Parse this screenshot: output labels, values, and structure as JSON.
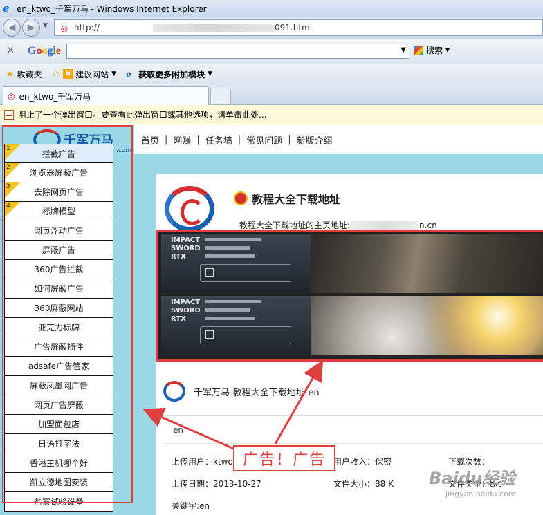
{
  "window": {
    "title": "en_ktwo_千军万马 - Windows Internet Explorer"
  },
  "address_bar": {
    "url_prefix": "http://",
    "url_suffix": "091.html"
  },
  "google_toolbar": {
    "logo": "Google",
    "search_label": "搜索"
  },
  "favorites_bar": {
    "favorites": "收藏夹",
    "suggested": "建议网站",
    "addons": "获取更多附加模块"
  },
  "tab": {
    "title": "en_ktwo_千军万马"
  },
  "info_bar": {
    "text": "阻止了一个弹出窗口。要查看此弹出窗口或其他选项，请单击此处..."
  },
  "site": {
    "logo_text": "千军万马",
    "logo_suffix": ".com",
    "nav": [
      "首页",
      "网赚",
      "任务墙",
      "常见问题",
      "新版介绍"
    ]
  },
  "sidebar": {
    "items": [
      "拦截广告",
      "浏览器屏蔽广告",
      "去除网页广告",
      "标牌模型",
      "网页浮动广告",
      "屏蔽广告",
      "360广告拦截",
      "如何屏蔽广告",
      "360屏蔽网站",
      "亚克力标牌",
      "广告屏蔽插件",
      "adsafe广告管家",
      "屏蔽凤凰网广告",
      "网页广告屏蔽",
      "加盟面包店",
      "日语打字法",
      "香港主机哪个好",
      "凯立德地图安装",
      "盐雾试验设备"
    ],
    "numbers": [
      "1",
      "2",
      "3",
      "4"
    ]
  },
  "main": {
    "headline": "教程大全下载地址",
    "homepage_label": "教程大全下载地址的主页地址:",
    "homepage_suffix": "n.cn",
    "ad_text": [
      "IMPACT",
      "SWORD",
      "RTX"
    ],
    "item_title": "千军万马-教程大全下载地址-en",
    "language": "en",
    "uploader_label": "上传用户：ktwo",
    "income_label": "用户收入：保密",
    "downloads_label": "下载次数：",
    "date_label": "上传日期：2013-10-27",
    "size_label": "文件大小：88 K",
    "type_label": "文件类型：txt",
    "keywords_label": "关键字:en"
  },
  "annotation": {
    "callout": "广告！广告"
  },
  "watermark": {
    "brand": "Baidu经验",
    "url": "jingyan.baidu.com"
  },
  "colors": {
    "annotation_red": "#e04040",
    "page_bg": "#9ad8e8",
    "brand_blue": "#1a56a8"
  }
}
